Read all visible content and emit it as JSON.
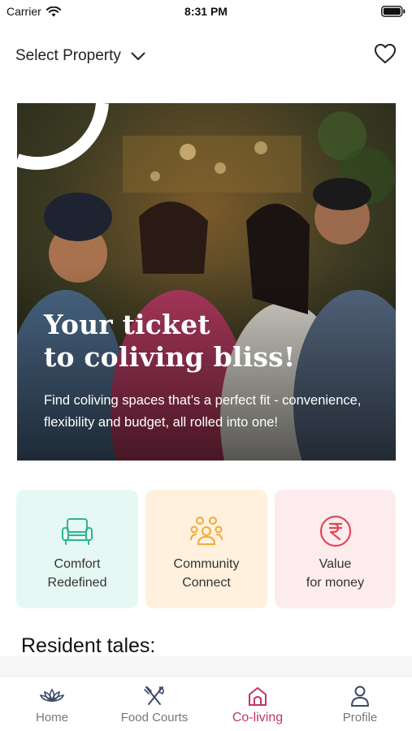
{
  "status_bar": {
    "carrier": "Carrier",
    "time": "8:31 PM"
  },
  "header": {
    "select_property": "Select Property"
  },
  "hero": {
    "title_line1": "Your ticket",
    "title_line2": "to coliving bliss!",
    "subtitle": "Find coliving spaces that’s a perfect fit - convenience, flexibility and budget, all rolled into one!"
  },
  "features": [
    {
      "line1": "Comfort",
      "line2": "Redefined",
      "icon": "sofa-icon",
      "bg": "#e6f8f3",
      "accent": "#2fb58f"
    },
    {
      "line1": "Community",
      "line2": "Connect",
      "icon": "community-icon",
      "bg": "#fff1de",
      "accent": "#f0a93a"
    },
    {
      "line1": "Value",
      "line2": "for money",
      "icon": "rupee-icon",
      "bg": "#fdecee",
      "accent": "#e0475a"
    }
  ],
  "resident": {
    "title": "Resident tales:"
  },
  "tabs": [
    {
      "label": "Home",
      "icon": "lotus-icon",
      "active": false
    },
    {
      "label": "Food Courts",
      "icon": "fork-knife-icon",
      "active": false
    },
    {
      "label": "Co-living",
      "icon": "house-icon",
      "active": true
    },
    {
      "label": "Profile",
      "icon": "person-icon",
      "active": false
    }
  ],
  "colors": {
    "active_tab": "#c2336b",
    "inactive_tab": "#777777"
  }
}
